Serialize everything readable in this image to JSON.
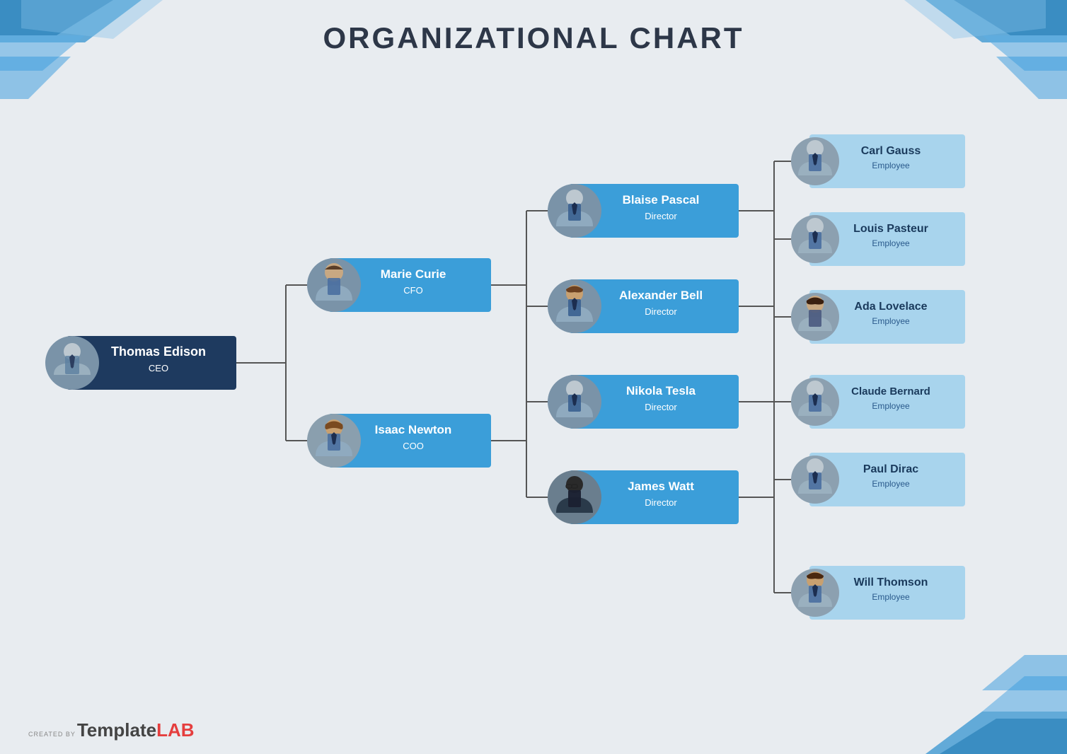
{
  "page": {
    "title": "ORGANIZATIONAL CHART",
    "background_color": "#e8ecf0"
  },
  "nodes": {
    "ceo": {
      "name": "Thomas Edison",
      "title": "CEO",
      "style": "dark",
      "avatar": "male1"
    },
    "vp": [
      {
        "name": "Marie Curie",
        "title": "CFO",
        "style": "blue",
        "avatar": "female1"
      },
      {
        "name": "Isaac Newton",
        "title": "COO",
        "style": "blue",
        "avatar": "male2"
      }
    ],
    "directors": [
      {
        "name": "Blaise Pascal",
        "title": "Director",
        "style": "blue",
        "avatar": "male3"
      },
      {
        "name": "Alexander Bell",
        "title": "Director",
        "style": "blue",
        "avatar": "male4"
      },
      {
        "name": "Nikola Tesla",
        "title": "Director",
        "style": "blue",
        "avatar": "male5"
      },
      {
        "name": "James Watt",
        "title": "Director",
        "style": "blue",
        "avatar": "male6"
      }
    ],
    "employees": [
      {
        "name": "Carl Gauss",
        "title": "Employee",
        "avatar": "male7"
      },
      {
        "name": "Louis Pasteur",
        "title": "Employee",
        "avatar": "male8"
      },
      {
        "name": "Ada Lovelace",
        "title": "Employee",
        "avatar": "female2"
      },
      {
        "name": "Claude Bernard",
        "title": "Employee",
        "avatar": "male9"
      },
      {
        "name": "Paul Dirac",
        "title": "Employee",
        "avatar": "male10"
      },
      {
        "name": "Will Thomson",
        "title": "Employee",
        "avatar": "male11"
      }
    ]
  },
  "footer": {
    "created_by": "CREATED BY",
    "template": "Template",
    "lab": "LAB"
  },
  "colors": {
    "dark_blue": "#1e3a5f",
    "medium_blue": "#3b9ed9",
    "light_blue": "#a8d4ed",
    "avatar_bg": "#8ca0b0"
  }
}
